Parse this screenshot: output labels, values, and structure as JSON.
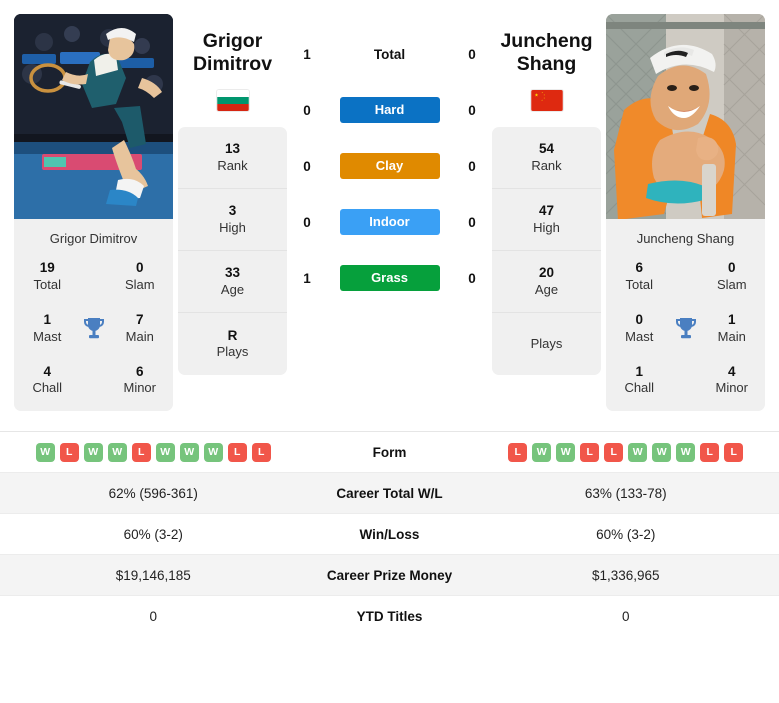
{
  "players": {
    "left": {
      "first_name": "Grigor",
      "last_name": "Dimitrov",
      "full_name": "Grigor Dimitrov",
      "country": "Bulgaria",
      "flag": "bulgaria-flag",
      "rank_stats": [
        {
          "value": "13",
          "label": "Rank"
        },
        {
          "value": "3",
          "label": "High"
        },
        {
          "value": "33",
          "label": "Age"
        },
        {
          "value": "R",
          "label": "Plays"
        }
      ],
      "titles": [
        {
          "value": "19",
          "label": "Total"
        },
        {
          "value": "0",
          "label": "Slam"
        },
        {
          "value": "1",
          "label": "Mast"
        },
        {
          "value": "7",
          "label": "Main"
        },
        {
          "value": "4",
          "label": "Chall"
        },
        {
          "value": "6",
          "label": "Minor"
        }
      ],
      "form": [
        "W",
        "L",
        "W",
        "W",
        "L",
        "W",
        "W",
        "W",
        "L",
        "L"
      ],
      "career_total_wl": "62% (596-361)",
      "win_loss": "60% (3-2)",
      "career_prize_money": "$19,146,185",
      "ytd_titles": "0"
    },
    "right": {
      "first_name": "Juncheng",
      "last_name": "Shang",
      "full_name": "Juncheng Shang",
      "country": "China",
      "flag": "china-flag",
      "rank_stats": [
        {
          "value": "54",
          "label": "Rank"
        },
        {
          "value": "47",
          "label": "High"
        },
        {
          "value": "20",
          "label": "Age"
        },
        {
          "value": "",
          "label": "Plays"
        }
      ],
      "titles": [
        {
          "value": "6",
          "label": "Total"
        },
        {
          "value": "0",
          "label": "Slam"
        },
        {
          "value": "0",
          "label": "Mast"
        },
        {
          "value": "1",
          "label": "Main"
        },
        {
          "value": "1",
          "label": "Chall"
        },
        {
          "value": "4",
          "label": "Minor"
        }
      ],
      "form": [
        "L",
        "W",
        "W",
        "L",
        "L",
        "W",
        "W",
        "W",
        "L",
        "L"
      ],
      "career_total_wl": "63% (133-78)",
      "win_loss": "60% (3-2)",
      "career_prize_money": "$1,336,965",
      "ytd_titles": "0"
    }
  },
  "head_to_head": [
    {
      "left": "1",
      "label": "Total",
      "right": "0",
      "badge": false,
      "color": ""
    },
    {
      "left": "0",
      "label": "Hard",
      "right": "0",
      "badge": true,
      "color": "#0b72c4"
    },
    {
      "left": "0",
      "label": "Clay",
      "right": "0",
      "badge": true,
      "color": "#e08a00"
    },
    {
      "left": "0",
      "label": "Indoor",
      "right": "0",
      "badge": true,
      "color": "#3aa0f5"
    },
    {
      "left": "1",
      "label": "Grass",
      "right": "0",
      "badge": true,
      "color": "#06a03c"
    }
  ],
  "stat_rows": [
    {
      "label": "Form"
    },
    {
      "label": "Career Total W/L"
    },
    {
      "label": "Win/Loss"
    },
    {
      "label": "Career Prize Money"
    },
    {
      "label": "YTD Titles"
    }
  ],
  "colors": {
    "win": "#76c47c",
    "loss": "#f1564a",
    "panel": "#f0f0f0",
    "trophy": "#4a7fc1"
  }
}
